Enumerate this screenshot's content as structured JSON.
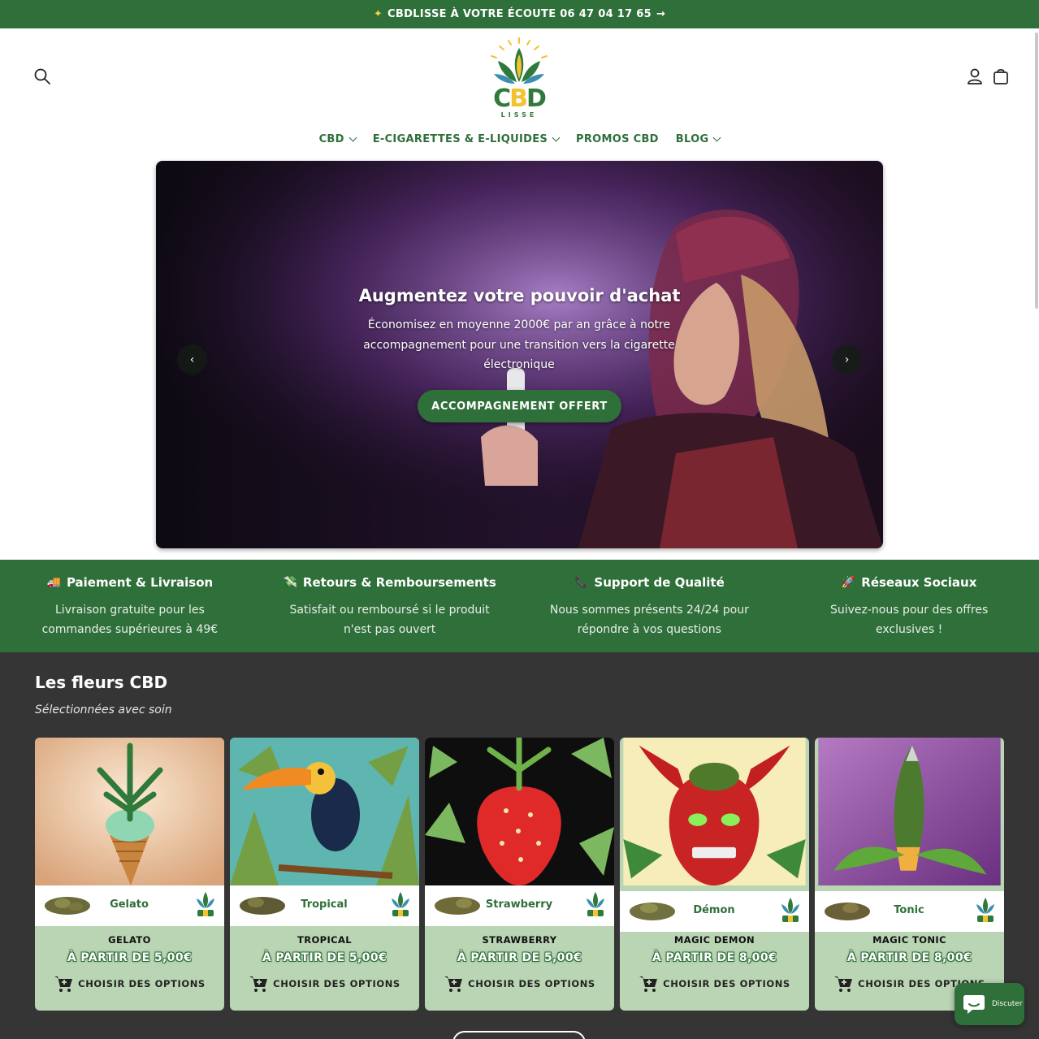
{
  "announcement": {
    "text": "CBDLISSE À VOTRE ÉCOUTE 06 47 04 17 65"
  },
  "header": {
    "logo_text_c": "C",
    "logo_text_b": "B",
    "logo_text_d": "D",
    "logo_sub": "LISSE"
  },
  "nav": {
    "items": [
      {
        "label": "CBD",
        "dropdown": true
      },
      {
        "label": "E-CIGARETTES & E-LIQUIDES",
        "dropdown": true
      },
      {
        "label": "PROMOS CBD",
        "dropdown": false
      },
      {
        "label": "BLOG",
        "dropdown": true
      }
    ]
  },
  "hero": {
    "title": "Augmentez votre pouvoir d'achat",
    "text": "Économisez en moyenne 2000€ par an grâce à notre accompagnement pour une transition vers la cigarette électronique",
    "cta": "ACCOMPAGNEMENT OFFERT"
  },
  "features": [
    {
      "icon": "truck-icon",
      "emoji": "🚚",
      "title": "Paiement & Livraison",
      "text": "Livraison gratuite pour les commandes supérieures à 49€"
    },
    {
      "icon": "refund-icon",
      "emoji": "💸",
      "title": "Retours & Remboursements",
      "text": "Satisfait ou remboursé si le produit n'est pas ouvert"
    },
    {
      "icon": "phone-icon",
      "emoji": "📞",
      "title": "Support de Qualité",
      "text": "Nous sommes présents 24/24 pour répondre à vos questions"
    },
    {
      "icon": "rocket-icon",
      "emoji": "🚀",
      "title": "Réseaux Sociaux",
      "text": "Suivez-nous pour des offres exclusives !"
    }
  ],
  "collection": {
    "title": "Les fleurs CBD",
    "subtitle": "Sélectionnées avec soin",
    "products": [
      {
        "band_label": "Gelato",
        "name": "GELATO",
        "price": "À PARTIR DE 5,00€",
        "button": "CHOISIR DES OPTIONS",
        "image": "ice-cream-cone-cannabis"
      },
      {
        "band_label": "Tropical",
        "name": "TROPICAL",
        "price": "À PARTIR DE 5,00€",
        "button": "CHOISIR DES OPTIONS",
        "image": "toucan"
      },
      {
        "band_label": "Strawberry",
        "name": "STRAWBERRY",
        "price": "À PARTIR DE 5,00€",
        "button": "CHOISIR DES OPTIONS",
        "image": "strawberry"
      },
      {
        "band_label": "Démon",
        "name": "MAGIC DEMON",
        "price": "À PARTIR DE 8,00€",
        "button": "CHOISIR DES OPTIONS",
        "image": "red-demon"
      },
      {
        "band_label": "Tonic",
        "name": "MAGIC TONIC",
        "price": "À PARTIR DE 8,00€",
        "button": "CHOISIR DES OPTIONS",
        "image": "rocket-bud"
      }
    ]
  },
  "chat": {
    "label": "Discuter"
  },
  "colors": {
    "brand_green": "#2f6f3a",
    "card_bg": "#b9d5b4",
    "section_dark": "#353535",
    "logo_yellow": "#f2c230"
  }
}
